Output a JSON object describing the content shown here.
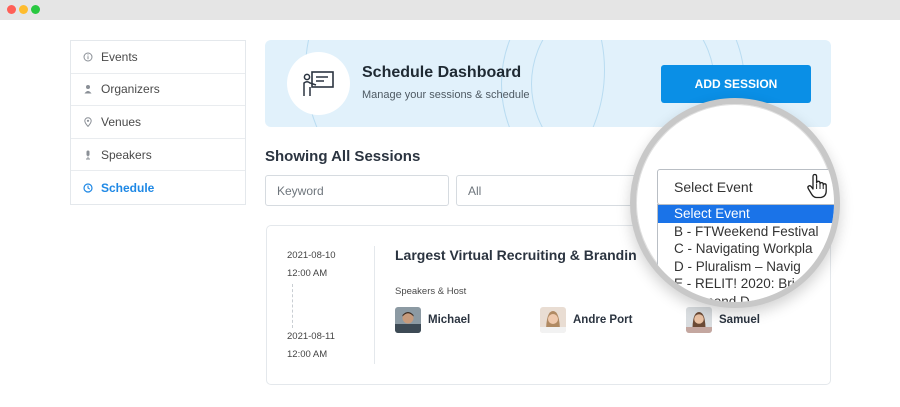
{
  "sidebar": {
    "items": [
      {
        "label": "Events",
        "icon": "info-circle-icon"
      },
      {
        "label": "Organizers",
        "icon": "user-icon"
      },
      {
        "label": "Venues",
        "icon": "map-pin-icon"
      },
      {
        "label": "Speakers",
        "icon": "microphone-icon"
      },
      {
        "label": "Schedule",
        "icon": "clock-icon",
        "active": true
      }
    ]
  },
  "header": {
    "title": "Schedule Dashboard",
    "subtitle": "Manage your sessions & schedule",
    "add_button": "ADD SESSION",
    "icon": "presentation-icon"
  },
  "section_title": "Showing All Sessions",
  "filters": {
    "keyword_placeholder": "Keyword",
    "category_value": "All",
    "event_select": {
      "value": "Select Event",
      "options": [
        "Select Event",
        "B - FTWeekend Festival",
        "C - Navigating Workpla",
        "D - Pluralism – Navig",
        "E - RELIT! 2020: Bri",
        "- Diamond D"
      ]
    }
  },
  "session": {
    "start_date": "2021-08-10",
    "start_time": "12:00 AM",
    "end_date": "2021-08-11",
    "end_time": "12:00 AM",
    "title": "Largest Virtual Recruiting & Brandin",
    "speakers_label": "Speakers & Host",
    "speakers": [
      "Michael",
      "Andre Port",
      "Samuel"
    ]
  },
  "colors": {
    "accent": "#0a8fe6",
    "banner_bg": "#e1f1fb",
    "active_nav": "#1e88e5",
    "dropdown_highlight": "#1a73e8"
  }
}
